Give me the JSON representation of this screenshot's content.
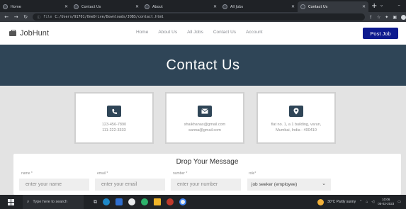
{
  "browser": {
    "tabs": [
      {
        "title": "Home",
        "active": false
      },
      {
        "title": "Contact Us",
        "active": false
      },
      {
        "title": "About",
        "active": false
      },
      {
        "title": "All Jobs",
        "active": false
      },
      {
        "title": "Contact Us",
        "active": true
      }
    ],
    "url": "C:/Users/91701/OneDrive/Downloads/JOBS/contact.html",
    "url_prefix": "File"
  },
  "site": {
    "brand": "JobHunt",
    "nav": [
      "Home",
      "About Us",
      "All Jobs",
      "Contact Us",
      "Account"
    ],
    "post_job": "Post Job"
  },
  "hero": {
    "title": "Contact Us"
  },
  "cards": [
    {
      "icon": "phone-icon",
      "lines": [
        "123-456-7890",
        "111-222-3333"
      ]
    },
    {
      "icon": "envelope-icon",
      "lines": [
        "shaikhanas@gmail.com",
        "sanna@gmail.com"
      ]
    },
    {
      "icon": "map-marker-icon",
      "lines": [
        "flat no. 1, a 1 building, varun,",
        "Mumbai, India - 400410"
      ]
    }
  ],
  "form": {
    "title": "Drop Your Message",
    "name_label": "name *",
    "email_label": "email *",
    "number_label": "number *",
    "role_label": "role*",
    "name_placeholder": "enter your name",
    "email_placeholder": "enter your email",
    "number_placeholder": "enter your number",
    "role_value": "job seeker (employee)"
  },
  "taskbar": {
    "search_placeholder": "Type here to search",
    "weather": "30°C Partly sunny",
    "time": "10:06",
    "date": "05-02-2023"
  },
  "colors": {
    "hero_bg": "#2f4557",
    "post_job_bg": "#0d1a8f",
    "section_bg": "#e3e3e3"
  }
}
